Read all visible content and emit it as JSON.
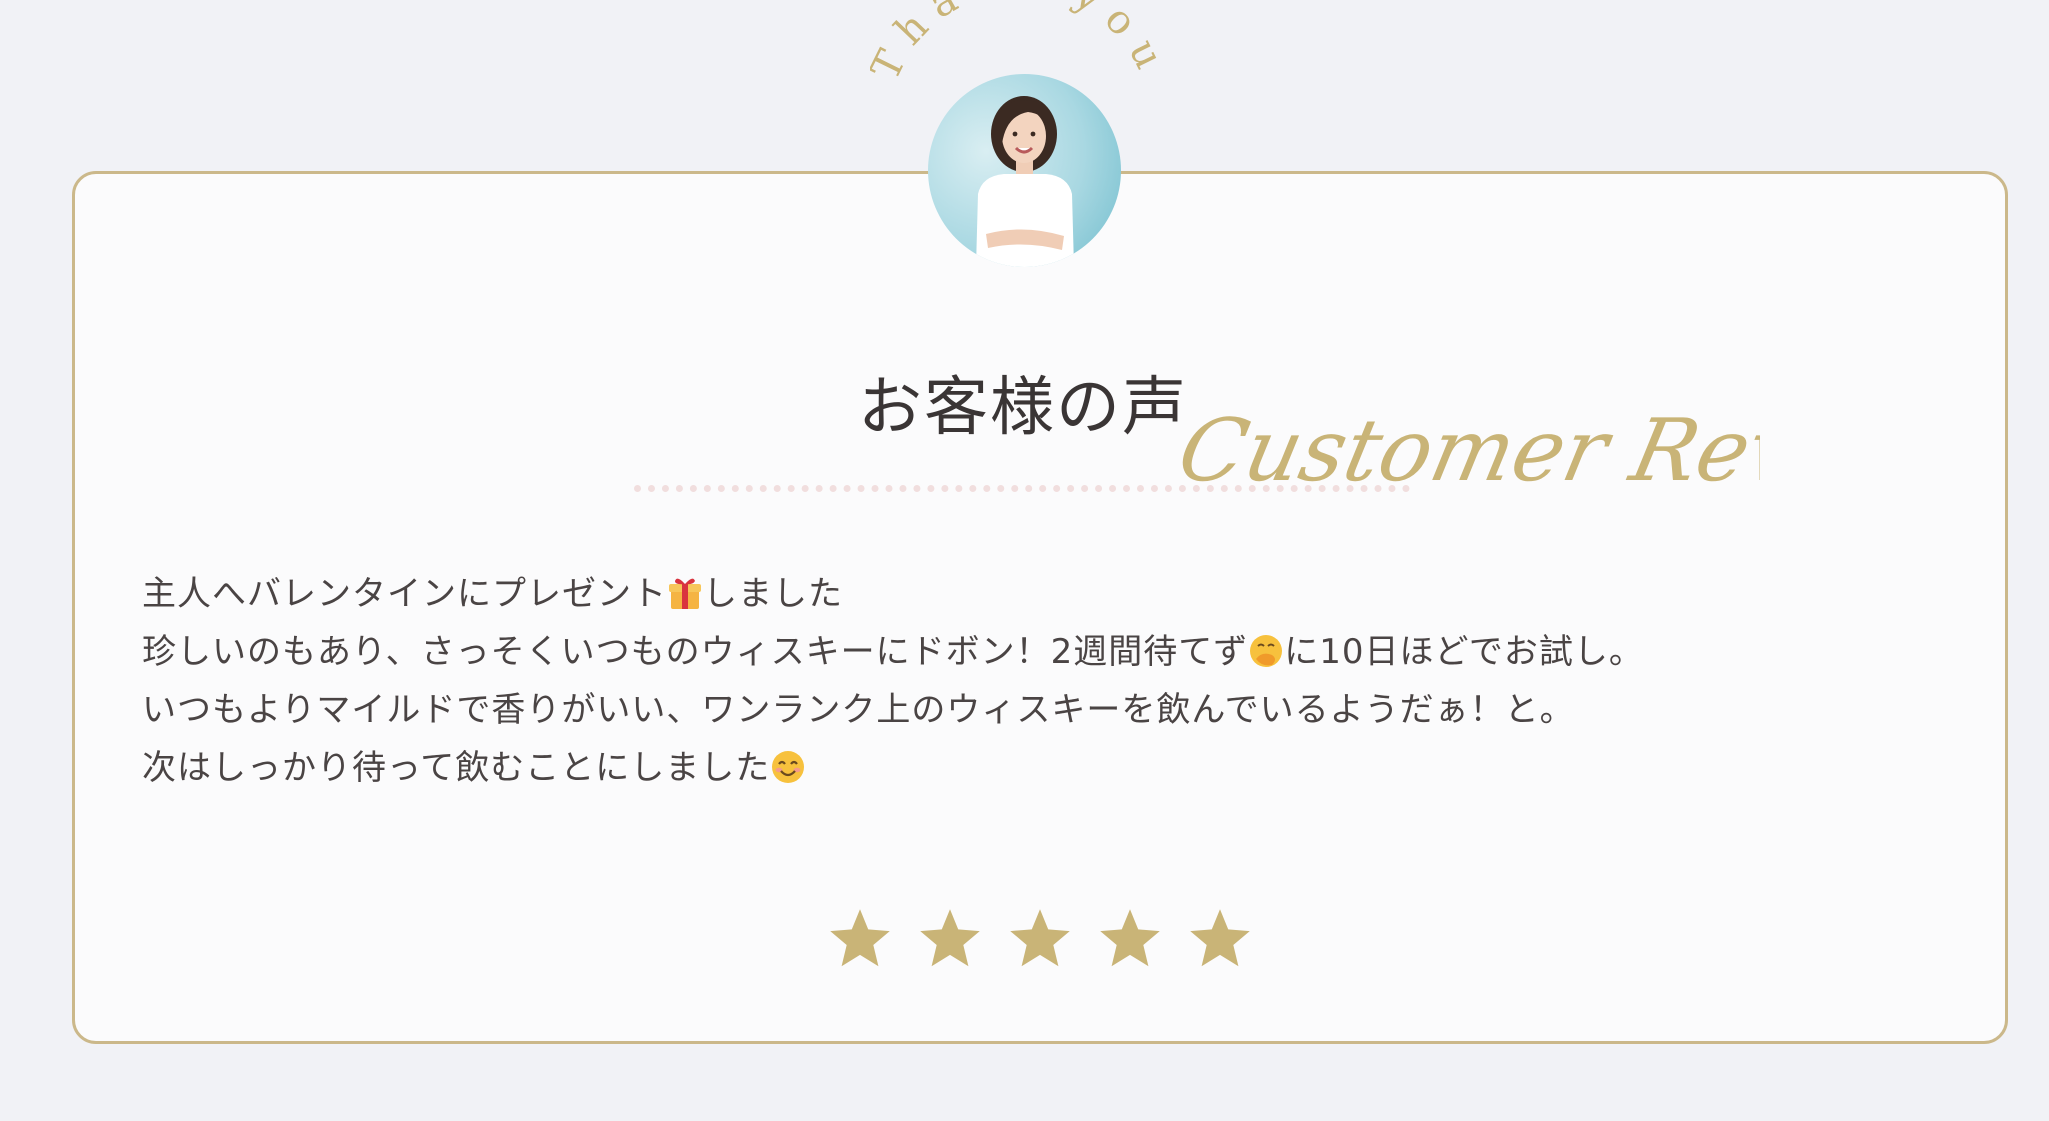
{
  "badge": {
    "text": "Thank you"
  },
  "heading": {
    "ja": "お客様の声",
    "en": "Customer Review"
  },
  "review": {
    "line1_a": "主人へバレンタインにプレゼント",
    "line1_b": "しました",
    "line2_a": "珍しいのもあり、さっそくいつものウィスキーにドボン！2週間待てず",
    "line2_b": "に10日ほどでお試し。",
    "line3": "いつもよりマイルドで香りがいい、ワンランク上のウィスキーを飲んでいるようだぁ！と。",
    "line4_a": "次はしっかり待って飲むことにしました"
  },
  "rating": {
    "stars": 5,
    "max": 5
  },
  "icons": [
    "gift-icon",
    "hand-over-mouth-face-icon",
    "smiling-face-icon",
    "star-icon"
  ],
  "colors": {
    "accent": "#c9b477",
    "border": "#cbb88a",
    "background": "#f1f2f6",
    "card": "#fbfbfc",
    "text": "#4a4444"
  }
}
